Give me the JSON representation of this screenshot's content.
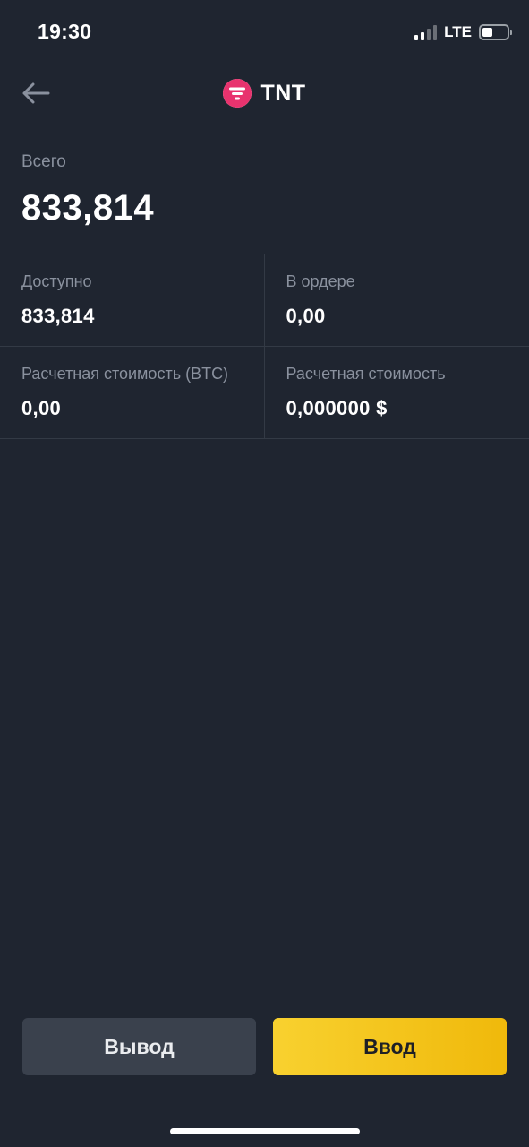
{
  "status_bar": {
    "time": "19:30",
    "network": "LTE",
    "signal_bars_active": 2,
    "signal_bars_total": 4,
    "battery_level_fraction": 0.35
  },
  "header": {
    "back_icon": "arrow-left-icon",
    "coin_icon": "tnt-coin-logo",
    "title": "TNT"
  },
  "total": {
    "label": "Всего",
    "value": "833,814"
  },
  "balances": [
    [
      {
        "label": "Доступно",
        "value": "833,814"
      },
      {
        "label": "В ордере",
        "value": "0,00"
      }
    ],
    [
      {
        "label": "Расчетная стоимость (BTC)",
        "value": "0,00"
      },
      {
        "label": "Расчетная стоимость",
        "value": "0,000000 $"
      }
    ]
  ],
  "actions": {
    "withdraw_label": "Вывод",
    "deposit_label": "Ввод"
  },
  "colors": {
    "background": "#1f2530",
    "accent": "#f0b90b",
    "coin_brand": "#e8336e",
    "muted_text": "#8a919e"
  }
}
